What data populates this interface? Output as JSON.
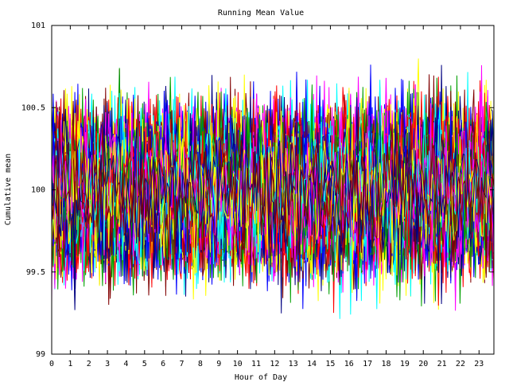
{
  "chart_data": {
    "type": "line",
    "title": "Running Mean Value",
    "xlabel": "Hour of Day",
    "ylabel": "Cumulative mean",
    "xlim": [
      0,
      23.8
    ],
    "ylim": [
      99,
      101
    ],
    "x_ticks": [
      "0",
      "1",
      "2",
      "3",
      "4",
      "5",
      "6",
      "7",
      "8",
      "9",
      "10",
      "11",
      "12",
      "13",
      "14",
      "15",
      "16",
      "17",
      "18",
      "19",
      "20",
      "21",
      "22",
      "23"
    ],
    "y_ticks": [
      "99",
      "99.5",
      "100",
      "100.5",
      "101"
    ],
    "y_tick_values": [
      99,
      99.5,
      100,
      100.5,
      101
    ],
    "grid": true,
    "legend": "none",
    "series_colors": [
      "#0000ff",
      "#ff0000",
      "#00a000",
      "#00ffff",
      "#ff00ff",
      "#ffff00",
      "#000080",
      "#800000"
    ],
    "series_count": 200,
    "points_per_series": 288,
    "center": 100,
    "noise_sd": 0.2,
    "observed_min": 99.0,
    "observed_max": 100.8
  }
}
